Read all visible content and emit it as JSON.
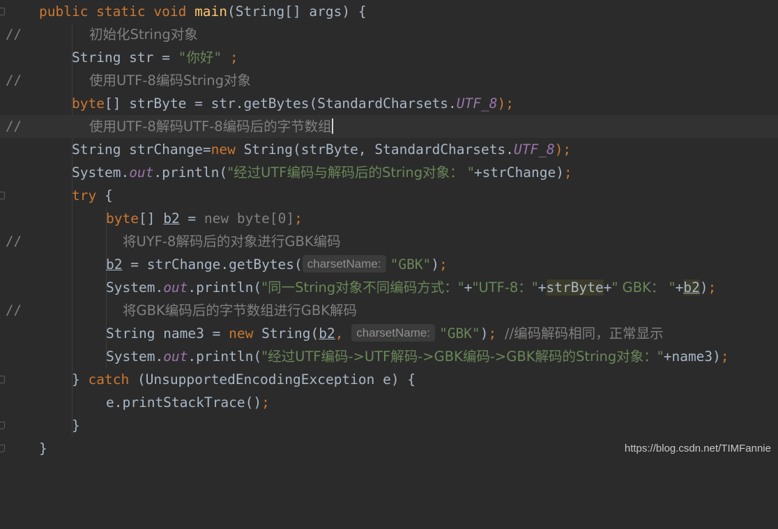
{
  "editor": {
    "language": "java",
    "colors": {
      "background": "#2b2b2b",
      "keyword": "#cc7832",
      "method_decl": "#ffc66d",
      "string": "#6a8759",
      "comment": "#808080",
      "static_field": "#9876aa",
      "plain": "#a9b7c6"
    },
    "comment_marker": "//",
    "lines": {
      "l1": {
        "t1": "public static void ",
        "t2": "main",
        "t3": "(String[] args) {"
      },
      "l2": {
        "t1": "初始化String对象"
      },
      "l3": {
        "t1": "String str = ",
        "t2": "\"你好\"",
        "t3": " ;"
      },
      "l4": {
        "t1": "使用UTF-8编码String对象"
      },
      "l5": {
        "t1": "byte",
        "t2": "[] strByte = str.getBytes(StandardCharsets.",
        "t3": "UTF_8",
        "t4": ");"
      },
      "l6": {
        "t1": "使用UTF-8解码UTF-8编码后的字节数组"
      },
      "l7": {
        "t1": "String strChange=",
        "t2": "new ",
        "t3": "String(strByte, StandardCharsets.",
        "t4": "UTF_8",
        "t5": ");"
      },
      "l8": {
        "t1": "System.",
        "t2": "out",
        "t3": ".println(",
        "t4": "\"经过UTF编码与解码后的String对象： \"",
        "t5": "+strChange)",
        "t6": ";"
      },
      "l9": {
        "t1": "try",
        "t2": " {"
      },
      "l10": {
        "t1": "byte",
        "t2": "[] ",
        "t3": "b2",
        "t4": " = ",
        "t5": "new byte[0]",
        "t6": ";"
      },
      "l11": {
        "t1": "将UYF-8解码后的对象进行GBK编码"
      },
      "l12": {
        "t1": "b2",
        "t2": " = strChange.getBytes(",
        "hint": "charsetName:",
        "t3": "\"GBK\"",
        "t4": ")",
        "t5": ";"
      },
      "l13": {
        "t1": "System.",
        "t2": "out",
        "t3": ".println(",
        "t4": "\"同一String对象不同编码方式：\"",
        "t5": "+",
        "t6": "\"UTF-8：\"",
        "t7": "+",
        "t8": "strByte",
        "t9": "+",
        "t10": "\" GBK： \"",
        "t11": "+",
        "t12": "b2",
        "t13": ")",
        "t14": ";"
      },
      "l14": {
        "t1": "将GBK编码后的字节数组进行GBK解码"
      },
      "l15": {
        "t1": "String name3 = ",
        "t2": "new ",
        "t3": "String(",
        "t4": "b2",
        "t5": ", ",
        "hint": "charsetName:",
        "t6": "\"GBK\"",
        "t7": ")",
        "t8": "; ",
        "t9": "//编码解码相同，正常显示"
      },
      "l16": {
        "t1": "System.",
        "t2": "out",
        "t3": ".println(",
        "t4": "\"经过UTF编码->UTF解码->GBK编码->GBK解码的String对象：\"",
        "t5": "+name3)",
        "t6": ";"
      },
      "l17": {
        "t1": "} ",
        "t2": "catch ",
        "t3": "(UnsupportedEncodingException e) {"
      },
      "l18": {
        "t1": "e.printStackTrace()",
        "t2": ";"
      },
      "l19": {
        "t1": "}"
      },
      "l20": {
        "t1": "}"
      }
    }
  },
  "watermark": {
    "text": "https://blog.csdn.net/TIMFannie"
  }
}
